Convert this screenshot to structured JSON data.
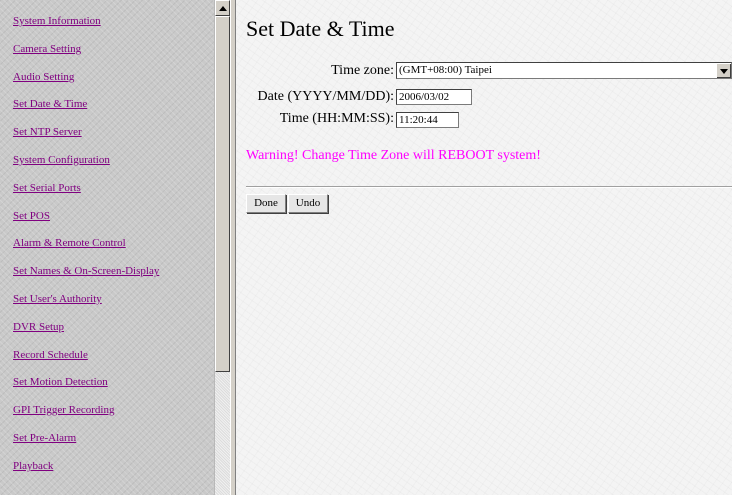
{
  "nav": {
    "items": [
      {
        "label": "System Information"
      },
      {
        "label": "Camera Setting"
      },
      {
        "label": "Audio Setting"
      },
      {
        "label": "Set Date & Time"
      },
      {
        "label": "Set NTP Server"
      },
      {
        "label": "System Configuration"
      },
      {
        "label": "Set Serial Ports"
      },
      {
        "label": "Set POS"
      },
      {
        "label": "Alarm & Remote Control"
      },
      {
        "label": "Set Names & On-Screen-Display"
      },
      {
        "label": "Set User's Authority"
      },
      {
        "label": "DVR Setup"
      },
      {
        "label": "Record Schedule"
      },
      {
        "label": "Set Motion Detection"
      },
      {
        "label": "GPI Trigger Recording"
      },
      {
        "label": "Set Pre-Alarm"
      },
      {
        "label": "Playback"
      }
    ]
  },
  "main": {
    "title": "Set Date & Time",
    "timezone_label": "Time zone:",
    "timezone_value": "(GMT+08:00) Taipei",
    "date_label": "Date (YYYY/MM/DD):",
    "date_value": "2006/03/02",
    "time_label": "Time (HH:MM:SS):",
    "time_value": "11:20:44",
    "warning": "Warning! Change Time Zone will REBOOT system!",
    "done_label": "Done",
    "undo_label": "Undo"
  },
  "colors": {
    "link": "#800080",
    "warning": "#ff00ff"
  },
  "icons": {
    "scroll_up": "triangle-up-icon",
    "dropdown": "triangle-down-icon"
  }
}
